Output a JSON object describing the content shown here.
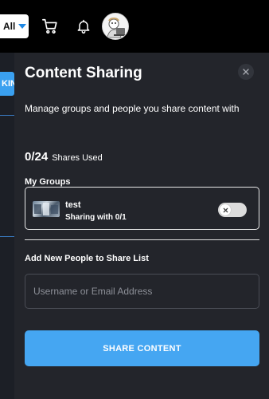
{
  "header": {
    "category_select": "All",
    "cart_icon": "cart-icon",
    "notification_icon": "bell-icon",
    "avatar": "user-avatar"
  },
  "background": {
    "partial_button_label": "KIN"
  },
  "panel": {
    "title": "Content Sharing",
    "close_icon": "close-icon",
    "description": "Manage groups and people you share content with",
    "shares_used": {
      "count": "0/24",
      "label": "Shares Used",
      "used": 0,
      "total": 24
    },
    "my_groups_label": "My Groups",
    "groups": [
      {
        "name": "test",
        "status": "Sharing with 0/1",
        "toggle_on": false
      }
    ],
    "add_people_label": "Add New People to Share List",
    "input_placeholder": "Username or Email Address",
    "input_value": "",
    "share_button": "SHARE CONTENT",
    "accent_color": "#45a6f2"
  }
}
